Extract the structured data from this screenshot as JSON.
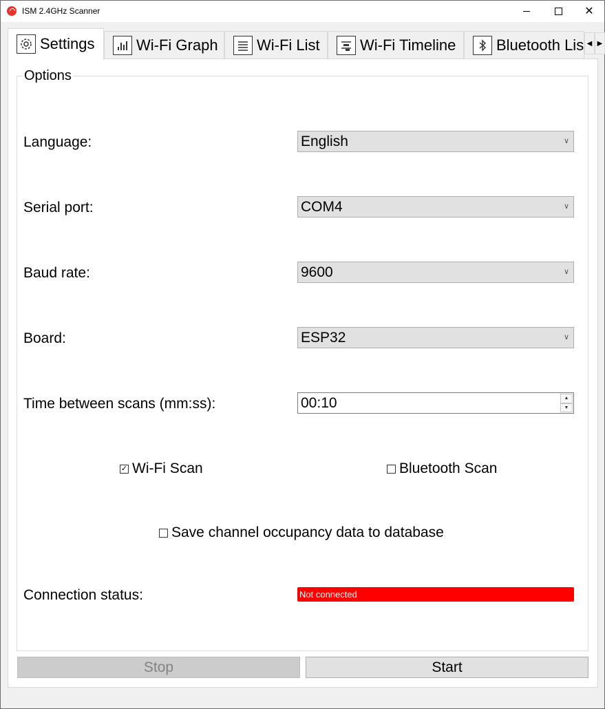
{
  "window": {
    "title": "ISM 2.4GHz Scanner"
  },
  "tabs": [
    {
      "label": "Settings",
      "icon": "gear-icon",
      "active": true
    },
    {
      "label": "Wi-Fi Graph",
      "icon": "bar-chart-icon"
    },
    {
      "label": "Wi-Fi List",
      "icon": "list-icon"
    },
    {
      "label": "Wi-Fi Timeline",
      "icon": "timeline-icon"
    },
    {
      "label": "Bluetooth Lis",
      "icon": "bluetooth-icon"
    }
  ],
  "options": {
    "title": "Options",
    "language": {
      "label": "Language:",
      "value": "English"
    },
    "serial_port": {
      "label": "Serial port:",
      "value": "COM4"
    },
    "baud_rate": {
      "label": "Baud rate:",
      "value": "9600"
    },
    "board": {
      "label": "Board:",
      "value": "ESP32"
    },
    "scan_interval": {
      "label": "Time between scans (mm:ss):",
      "value": "00:10"
    },
    "wifi_scan": {
      "label": "Wi-Fi Scan",
      "checked": true
    },
    "bluetooth_scan": {
      "label": "Bluetooth Scan",
      "checked": false
    },
    "save_db": {
      "label": "Save channel occupancy data to database",
      "checked": false
    },
    "connection_status": {
      "label": "Connection status:",
      "value": "Not connected",
      "color": "#ff0000"
    }
  },
  "buttons": {
    "stop": "Stop",
    "start": "Start"
  }
}
